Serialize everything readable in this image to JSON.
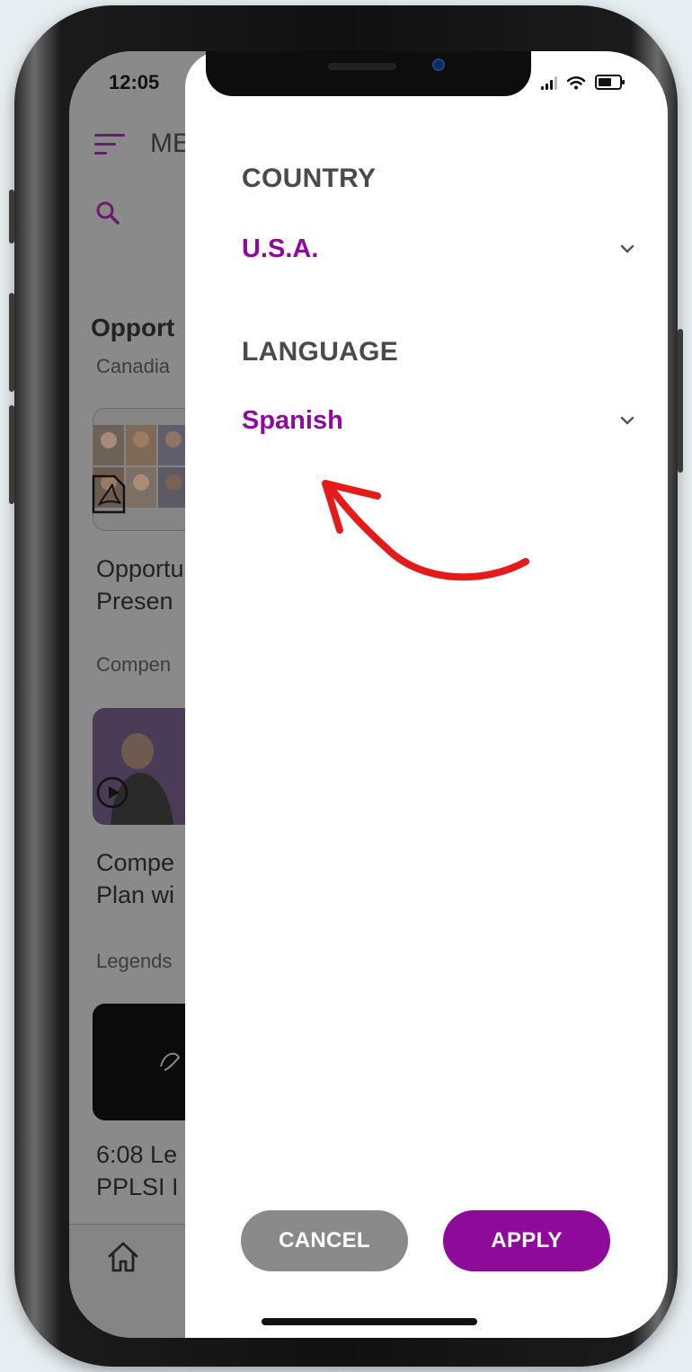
{
  "status_bar": {
    "time": "12:05"
  },
  "background_app": {
    "menu_label": "ME",
    "section_title": "Opport",
    "items": [
      {
        "category": "Canadia",
        "title_line1": "Opportu",
        "title_line2": "Presen"
      },
      {
        "category": "Compen",
        "title_line1": "Compe",
        "title_line2": "Plan wi"
      },
      {
        "category": "Legends",
        "title_line1": "6:08 Le",
        "title_line2": "PPLSI I"
      }
    ]
  },
  "drawer": {
    "country_label": "COUNTRY",
    "country_value": "U.S.A.",
    "language_label": "LANGUAGE",
    "language_value": "Spanish",
    "cancel_label": "CANCEL",
    "apply_label": "APPLY"
  },
  "colors": {
    "accent_purple": "#8d0a9b",
    "cancel_gray": "#8a8a8a",
    "annotation_red": "#e31b1b"
  }
}
